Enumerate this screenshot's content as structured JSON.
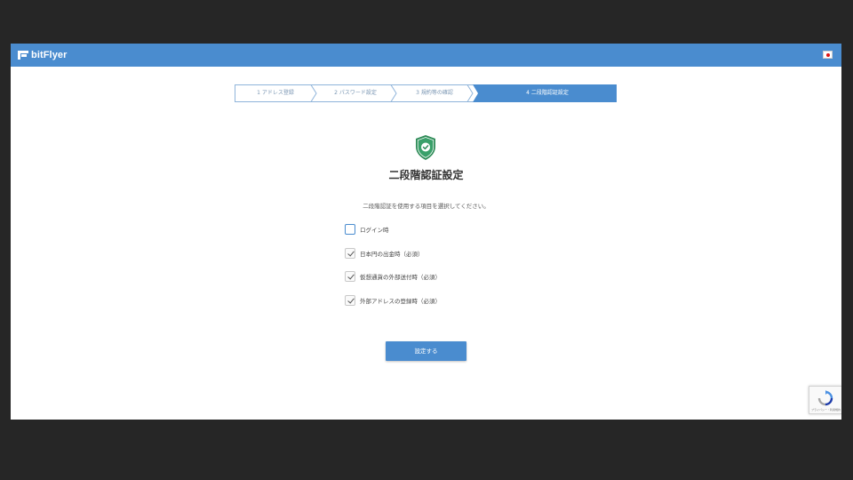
{
  "header": {
    "logo_text": "bitFlyer",
    "language_flag": "japan-flag-icon"
  },
  "steps": [
    {
      "label": "1 アドレス登録",
      "active": false
    },
    {
      "label": "2 パスワード設定",
      "active": false
    },
    {
      "label": "3 規約等の確認",
      "active": false
    },
    {
      "label": "4 二段階認証設定",
      "active": true
    }
  ],
  "main": {
    "icon": "shield-check-icon",
    "title": "二段階認証設定",
    "description": "二段階認証を使用する項目を選択してください。",
    "options": [
      {
        "label": "ログイン時",
        "checked": false
      },
      {
        "label": "日本円の出金時（必須）",
        "checked": true
      },
      {
        "label": "仮想通貨の外部送付時（必須）",
        "checked": true
      },
      {
        "label": "外部アドレスの登録時（必須）",
        "checked": true
      }
    ],
    "submit_label": "設定する"
  },
  "recaptcha": {
    "icon": "recaptcha-icon",
    "text": "プライバシー・利用規約"
  },
  "colors": {
    "brand": "#4a8ccf",
    "shield": "#2e8b57",
    "background": "#262626"
  }
}
